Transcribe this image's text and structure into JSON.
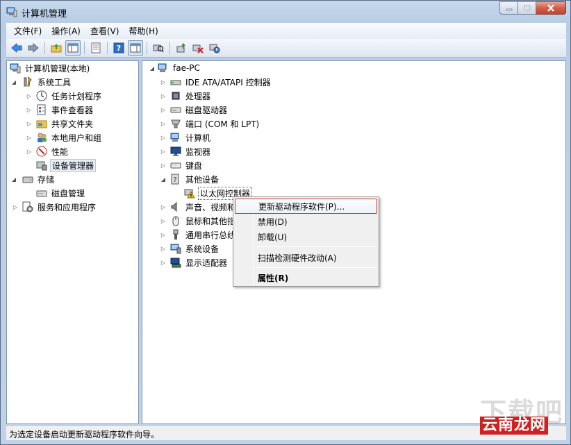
{
  "window": {
    "title": "计算机管理"
  },
  "menubar": {
    "items": [
      "文件(F)",
      "操作(A)",
      "查看(V)",
      "帮助(H)"
    ]
  },
  "left_tree": {
    "root": "计算机管理(本地)",
    "system_tools": "系统工具",
    "task_scheduler": "任务计划程序",
    "event_viewer": "事件查看器",
    "shared_folders": "共享文件夹",
    "local_users": "本地用户和组",
    "performance": "性能",
    "device_manager": "设备管理器",
    "storage": "存储",
    "disk_management": "磁盘管理",
    "services_apps": "服务和应用程序"
  },
  "device_tree": {
    "computer": "fae-PC",
    "ide": "IDE ATA/ATAPI 控制器",
    "processor": "处理器",
    "disk_drives": "磁盘驱动器",
    "ports": "端口 (COM 和 LPT)",
    "computer_node": "计算机",
    "monitors": "监视器",
    "keyboards": "键盘",
    "other_devices": "其他设备",
    "ethernet": "以太网控制器",
    "sound": "声音、视频和",
    "mice": "鼠标和其他指",
    "usb": "通用串行总线",
    "system_devices": "系统设备",
    "display_adapters": "显示适配器"
  },
  "context_menu": {
    "update_driver": "更新驱动程序软件(P)...",
    "disable": "禁用(D)",
    "uninstall": "卸载(U)",
    "scan": "扫描检测硬件改动(A)",
    "properties": "属性(R)"
  },
  "status": {
    "text": "为选定设备启动更新驱动程序软件向导。"
  },
  "watermark": {
    "text": "云南龙网",
    "grey": "下载吧"
  }
}
